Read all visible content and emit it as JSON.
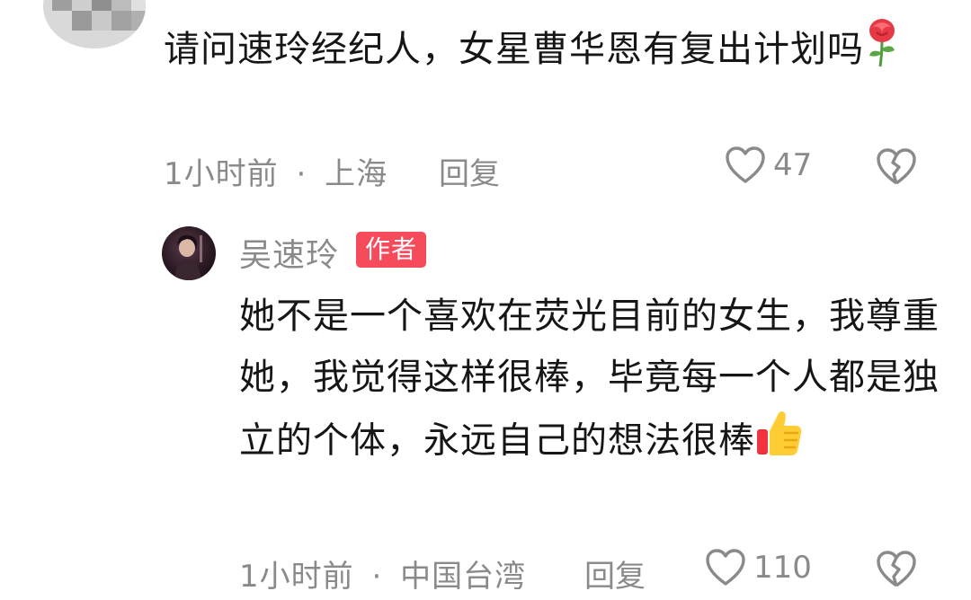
{
  "comment": {
    "text": "请问速玲经纪人，女星曹华恩有复出计划吗",
    "emoji_icon": "rose-icon",
    "time": "1小时前",
    "separator": "·",
    "location": "上海",
    "reply_label": "回复",
    "like_count": "47"
  },
  "reply": {
    "author": "吴速玲",
    "badge": "作者",
    "text": "她不是一个喜欢在荧光目前的女生，我尊重她，我觉得这样很棒，毕竟每一个人都是独立的个体，永远自己的想法很棒",
    "emoji_icon": "thumbs-up-icon",
    "time": "1小时前",
    "separator": "·",
    "location": "中国台湾",
    "reply_label": "回复",
    "like_count": "110"
  },
  "colors": {
    "badge": "#f64b5b",
    "meta_text": "#8a8a8a",
    "body_text": "#161616"
  }
}
